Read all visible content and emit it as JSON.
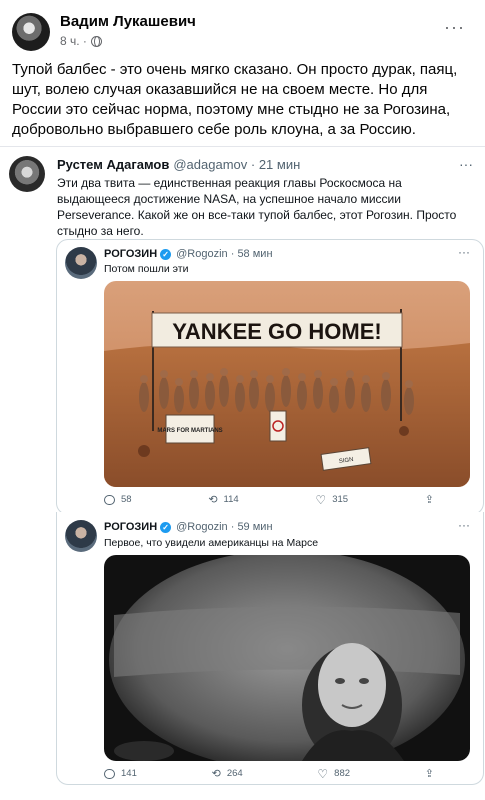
{
  "post": {
    "author": "Вадим Лукашевич",
    "time": "8 ч. ·",
    "text": "Тупой балбес - это очень мягко сказано. Он просто дурак, паяц, шут, волею случая оказавшийся не на своем месте. Но для России это сейчас норма, поэтому мне стыдно не за Рогозина, добровольно выбравшего себе роль клоуна, а за Россию.",
    "more_icon": "more-horizontal-icon",
    "privacy_icon": "globe-icon"
  },
  "tweet": {
    "name": "Рустем Адагамов",
    "handle": "@adagamov · 21 мин",
    "text": "Эти два твита — единственная реакция главы Роскосмоса на выдающееся достижение NASA, на успешное начало миссии Perseverance. Какой же он все-таки тупой балбес, этот Рогозин. Просто стыдно за него."
  },
  "quoted": [
    {
      "name": "РОГОЗИН",
      "handle": "@Rogozin · 58 мин",
      "text": "Потом пошли эти",
      "banner": "YANKEE GO HOME!",
      "sign1": "MARS FOR MARTIANS",
      "sign2": "SIGN",
      "replies": "58",
      "retweets": "114",
      "likes": "315"
    },
    {
      "name": "РОГОЗИН",
      "handle": "@Rogozin · 59 мин",
      "text": "Первое, что увидели американцы на Марсе",
      "replies": "141",
      "retweets": "264",
      "likes": "882"
    }
  ],
  "colors": {
    "accent": "#1d9bf0",
    "muted": "#536471",
    "mars": "#b5663a"
  }
}
